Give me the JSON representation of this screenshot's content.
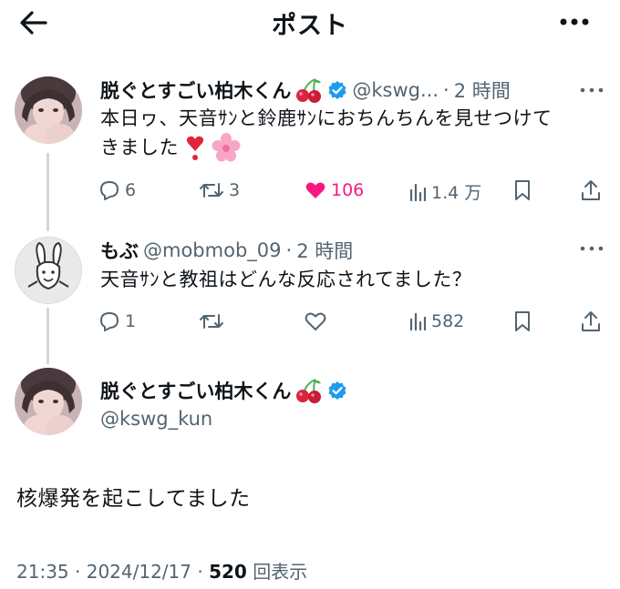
{
  "header": {
    "title": "ポスト"
  },
  "tweet1": {
    "name": "脱ぐとすごい柏木くん",
    "handle": "@kswg...",
    "time": "2 時間",
    "text_line1": "本日ヮ、天音ｻﾝと鈴鹿ｻﾝにおちんちんを見せつけて",
    "text_line2": "きました",
    "reply_count": "6",
    "repost_count": "3",
    "like_count": "106",
    "view_count": "1.4 万"
  },
  "tweet2": {
    "name": "もぶ",
    "handle": "@mobmob_09",
    "time": "2 時間",
    "text": "天音ｻﾝと教祖はどんな反応されてました？",
    "reply_count": "1",
    "view_count": "582"
  },
  "main": {
    "name": "脱ぐとすごい柏木くん",
    "handle": "@kswg_kun",
    "text": "核爆発を起こしてました",
    "time": "21:35",
    "date": "2024/12/17",
    "views": "520",
    "views_label": "回表示"
  },
  "colors": {
    "like": "#f91880",
    "verified": "#1d9bf0",
    "secondary": "#536471"
  },
  "icons": [
    "back-arrow-icon",
    "more-icon",
    "verified-badge-icon",
    "cherry-icon",
    "heart-emoji-icon",
    "flower-emoji-icon",
    "reply-icon",
    "repost-icon",
    "like-icon",
    "views-icon",
    "bookmark-icon",
    "share-icon"
  ]
}
